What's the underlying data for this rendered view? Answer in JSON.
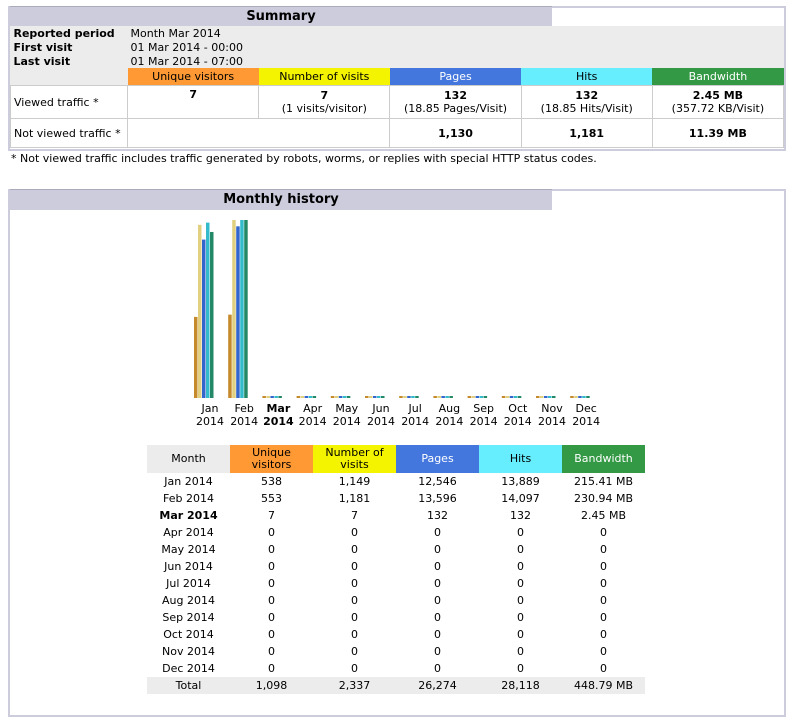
{
  "summary": {
    "title": "Summary",
    "reported_period_label": "Reported period",
    "reported_period_value": "Month Mar 2014",
    "first_visit_label": "First visit",
    "first_visit_value": "01 Mar 2014 - 00:00",
    "last_visit_label": "Last visit",
    "last_visit_value": "01 Mar 2014 - 07:00",
    "headers": [
      "Unique visitors",
      "Number of visits",
      "Pages",
      "Hits",
      "Bandwidth"
    ],
    "viewed": {
      "label": "Viewed traffic *",
      "unique": "7",
      "visits": "7",
      "visits_sub": "(1 visits/visitor)",
      "pages": "132",
      "pages_sub": "(18.85 Pages/Visit)",
      "hits": "132",
      "hits_sub": "(18.85 Hits/Visit)",
      "bandwidth": "2.45 MB",
      "bandwidth_sub": "(357.72 KB/Visit)"
    },
    "not_viewed": {
      "label": "Not viewed traffic *",
      "pages": "1,130",
      "hits": "1,181",
      "bandwidth": "11.39 MB"
    },
    "note": "* Not viewed traffic includes traffic generated by robots, worms, or replies with special HTTP status codes."
  },
  "monthly": {
    "title": "Monthly history",
    "columns": [
      "Month",
      "Unique visitors",
      "Number of visits",
      "Pages",
      "Hits",
      "Bandwidth"
    ],
    "rows": [
      [
        "Jan 2014",
        "538",
        "1,149",
        "12,546",
        "13,889",
        "215.41 MB"
      ],
      [
        "Feb 2014",
        "553",
        "1,181",
        "13,596",
        "14,097",
        "230.94 MB"
      ],
      [
        "Mar 2014",
        "7",
        "7",
        "132",
        "132",
        "2.45 MB"
      ],
      [
        "Apr 2014",
        "0",
        "0",
        "0",
        "0",
        "0"
      ],
      [
        "May 2014",
        "0",
        "0",
        "0",
        "0",
        "0"
      ],
      [
        "Jun 2014",
        "0",
        "0",
        "0",
        "0",
        "0"
      ],
      [
        "Jul 2014",
        "0",
        "0",
        "0",
        "0",
        "0"
      ],
      [
        "Aug 2014",
        "0",
        "0",
        "0",
        "0",
        "0"
      ],
      [
        "Sep 2014",
        "0",
        "0",
        "0",
        "0",
        "0"
      ],
      [
        "Oct 2014",
        "0",
        "0",
        "0",
        "0",
        "0"
      ],
      [
        "Nov 2014",
        "0",
        "0",
        "0",
        "0",
        "0"
      ],
      [
        "Dec 2014",
        "0",
        "0",
        "0",
        "0",
        "0"
      ]
    ],
    "total": [
      "Total",
      "1,098",
      "2,337",
      "26,274",
      "28,118",
      "448.79 MB"
    ],
    "current_month": "Mar 2014"
  },
  "chart_data": {
    "type": "bar",
    "categories": [
      "Jan 2014",
      "Feb 2014",
      "Mar 2014",
      "Apr 2014",
      "May 2014",
      "Jun 2014",
      "Jul 2014",
      "Aug 2014",
      "Sep 2014",
      "Oct 2014",
      "Nov 2014",
      "Dec 2014"
    ],
    "month_labels": [
      [
        "Jan",
        "2014"
      ],
      [
        "Feb",
        "2014"
      ],
      [
        "Mar",
        "2014"
      ],
      [
        "Apr",
        "2014"
      ],
      [
        "May",
        "2014"
      ],
      [
        "Jun",
        "2014"
      ],
      [
        "Jul",
        "2014"
      ],
      [
        "Aug",
        "2014"
      ],
      [
        "Sep",
        "2014"
      ],
      [
        "Oct",
        "2014"
      ],
      [
        "Nov",
        "2014"
      ],
      [
        "Dec",
        "2014"
      ]
    ],
    "series": [
      {
        "key": "unique",
        "color": "#c58a2b",
        "values": [
          538,
          553,
          7,
          0,
          0,
          0,
          0,
          0,
          0,
          0,
          0,
          0
        ]
      },
      {
        "key": "visits",
        "color": "#e0d080",
        "values": [
          1149,
          1181,
          7,
          0,
          0,
          0,
          0,
          0,
          0,
          0,
          0,
          0
        ]
      },
      {
        "key": "pages",
        "color": "#3366cc",
        "values": [
          12546,
          13596,
          132,
          0,
          0,
          0,
          0,
          0,
          0,
          0,
          0,
          0
        ]
      },
      {
        "key": "hits",
        "color": "#33bbcc",
        "values": [
          13889,
          14097,
          132,
          0,
          0,
          0,
          0,
          0,
          0,
          0,
          0,
          0
        ]
      },
      {
        "key": "bandwidth_mb",
        "color": "#228866",
        "values": [
          215.41,
          230.94,
          2.45,
          0,
          0,
          0,
          0,
          0,
          0,
          0,
          0,
          0
        ]
      }
    ],
    "scale_groups": [
      [
        "unique",
        "visits"
      ],
      [
        "pages",
        "hits"
      ],
      [
        "bandwidth_mb"
      ]
    ],
    "grid": false
  }
}
